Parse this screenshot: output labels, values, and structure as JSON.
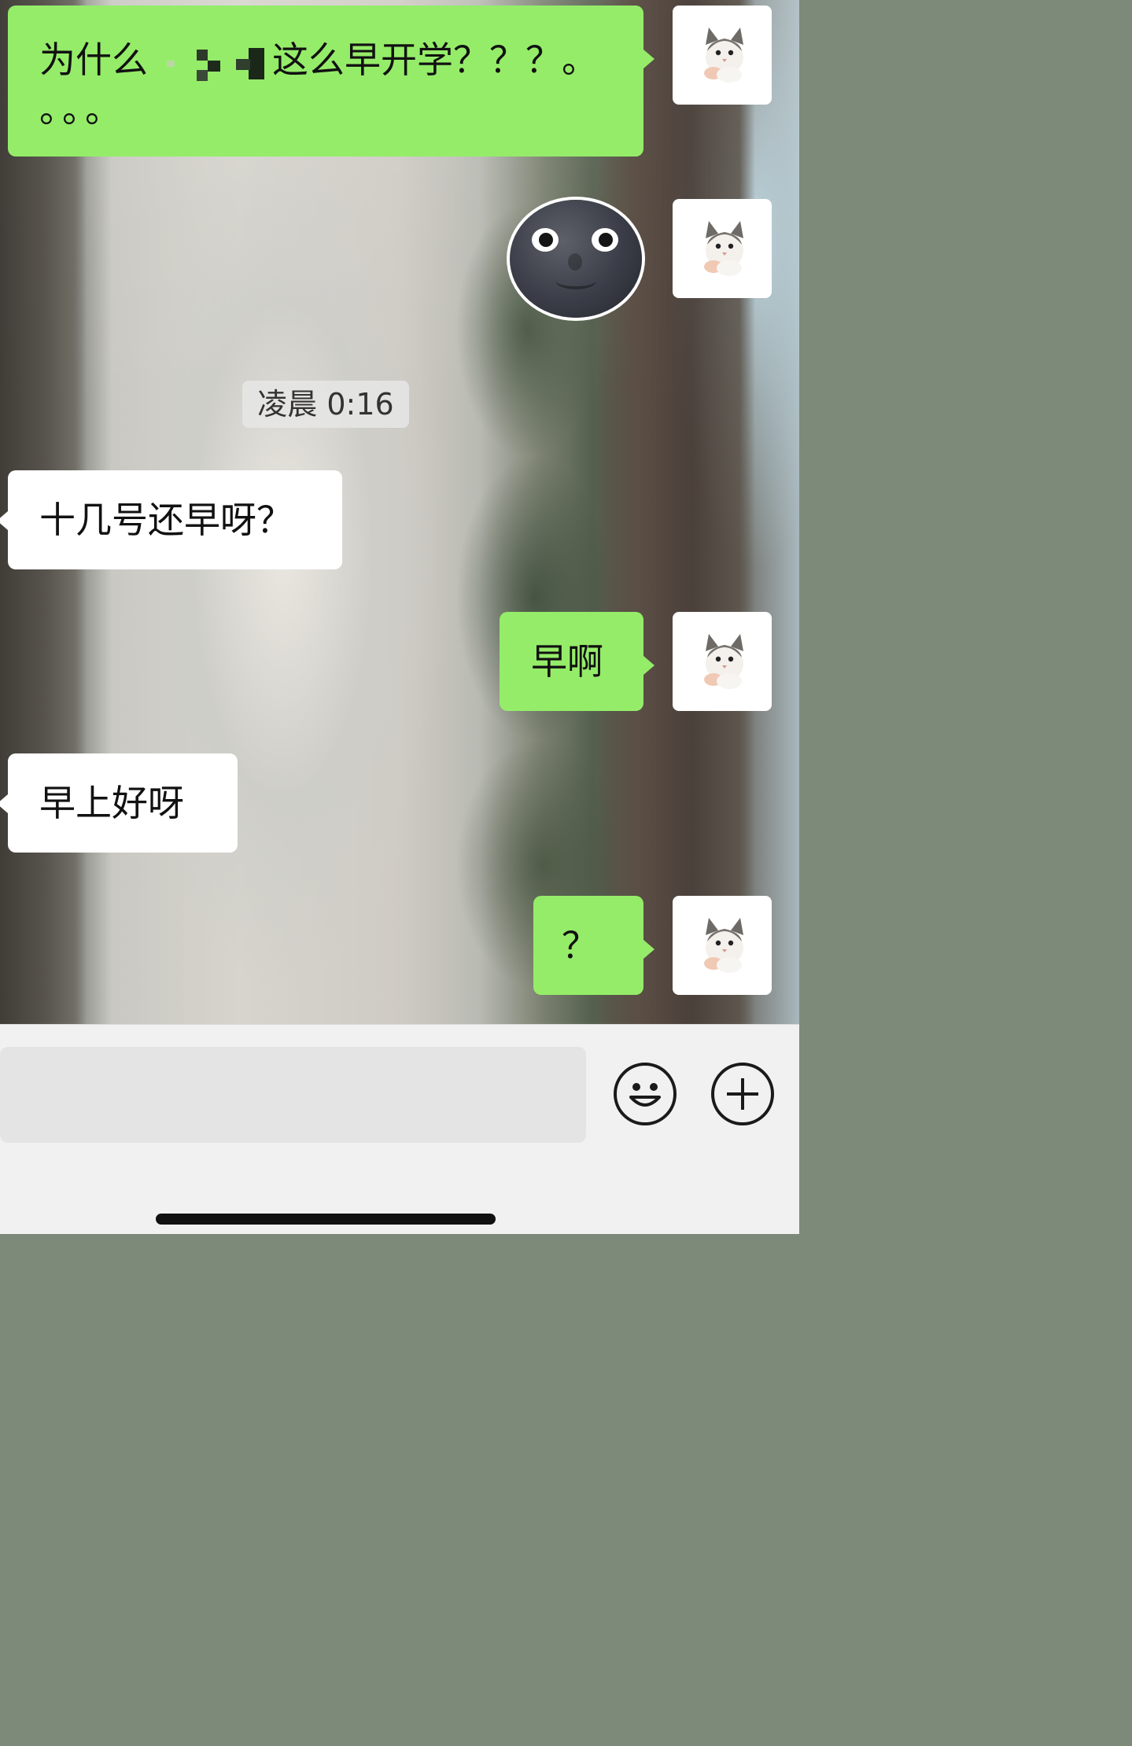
{
  "chat": {
    "timestamp": "凌晨 0:16",
    "messages": [
      {
        "sender": "self",
        "type": "text",
        "text_before": "为什么",
        "redacted": true,
        "text_after": "这么早开学？？？。",
        "text_line2": "。。。"
      },
      {
        "sender": "self",
        "type": "sticker",
        "sticker": "new-moon-face-icon"
      },
      {
        "sender": "other",
        "type": "text",
        "text": "十几号还早呀？"
      },
      {
        "sender": "self",
        "type": "text",
        "text": "早啊"
      },
      {
        "sender": "other",
        "type": "text",
        "text": "早上好呀"
      },
      {
        "sender": "self",
        "type": "text",
        "text": "？"
      }
    ],
    "self_avatar": "cat-avatar-icon"
  },
  "input_bar": {
    "placeholder": "",
    "emoji_button": "smiley-face-icon",
    "more_button": "plus-circle-icon"
  },
  "colors": {
    "self_bubble": "#95ec69",
    "other_bubble": "#ffffff",
    "input_bar_bg": "#f1f1f1"
  }
}
